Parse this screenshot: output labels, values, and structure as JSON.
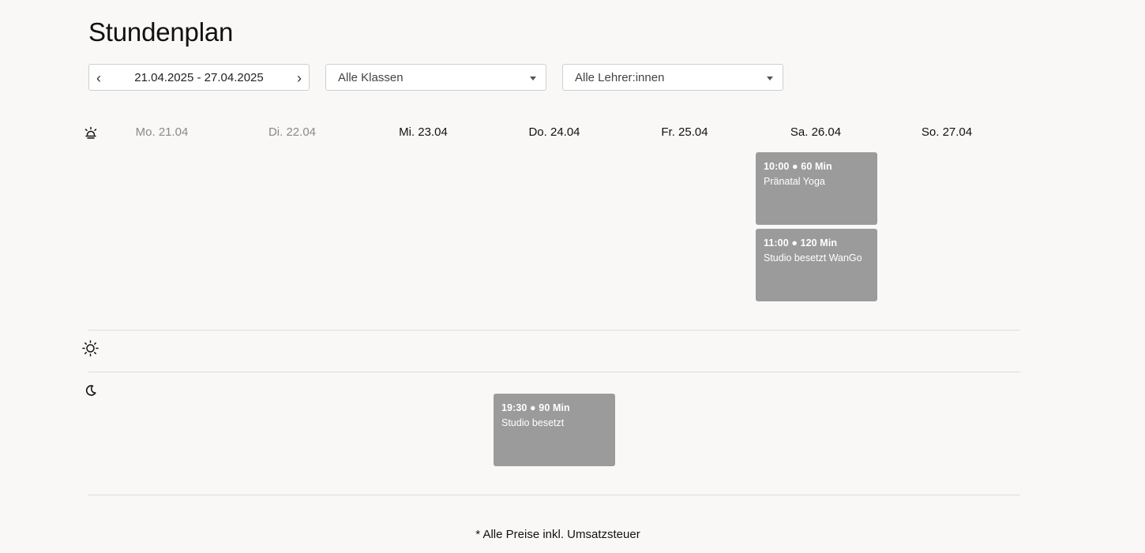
{
  "page": {
    "title": "Stundenplan"
  },
  "filters": {
    "date_range": "21.04.2025 - 27.04.2025",
    "prev_label": "‹",
    "next_label": "›",
    "classes": "Alle Klassen",
    "teachers": "Alle Lehrer:innen"
  },
  "days": [
    {
      "label": "Mo. 21.04",
      "past": true
    },
    {
      "label": "Di. 22.04",
      "past": true
    },
    {
      "label": "Mi. 23.04",
      "past": false
    },
    {
      "label": "Do. 24.04",
      "past": false
    },
    {
      "label": "Fr. 25.04",
      "past": false
    },
    {
      "label": "Sa. 26.04",
      "past": false
    },
    {
      "label": "So. 27.04",
      "past": false
    }
  ],
  "sections": {
    "morning": {
      "icon": "sunrise-icon"
    },
    "midday": {
      "icon": "sun-icon"
    },
    "evening": {
      "icon": "moon-icon"
    }
  },
  "events": [
    {
      "day": "Sa. 26.04",
      "section": "morning",
      "time": "10:00 ● 60 Min",
      "name": "Pränatal Yoga"
    },
    {
      "day": "Sa. 26.04",
      "section": "morning",
      "time": "11:00 ● 120 Min",
      "name": "Studio besetzt WanGo"
    },
    {
      "day": "Do. 24.04",
      "section": "evening",
      "time": "19:30 ● 90 Min",
      "name": "Studio besetzt"
    }
  ],
  "footer": {
    "note": "* Alle Preise inkl. Umsatzsteuer"
  },
  "colors": {
    "background": "#f9f8f7",
    "event": "#9b9b9b",
    "past_day": "#8a8a8a"
  }
}
